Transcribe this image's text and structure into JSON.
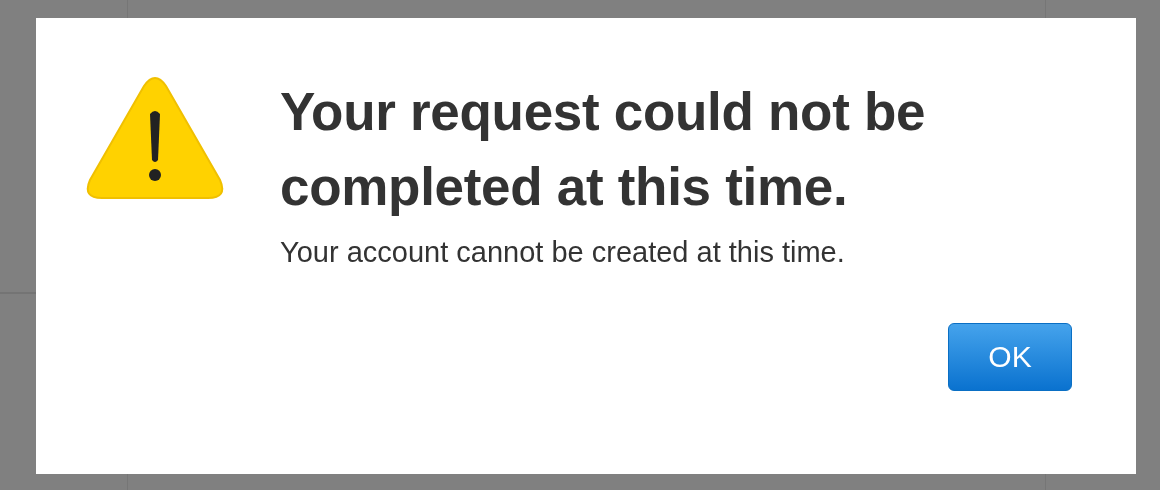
{
  "dialog": {
    "title": "Your request could not be completed at this time.",
    "message": "Your account cannot be created at this time.",
    "buttons": [
      {
        "label": "OK",
        "kind": "default"
      }
    ]
  }
}
